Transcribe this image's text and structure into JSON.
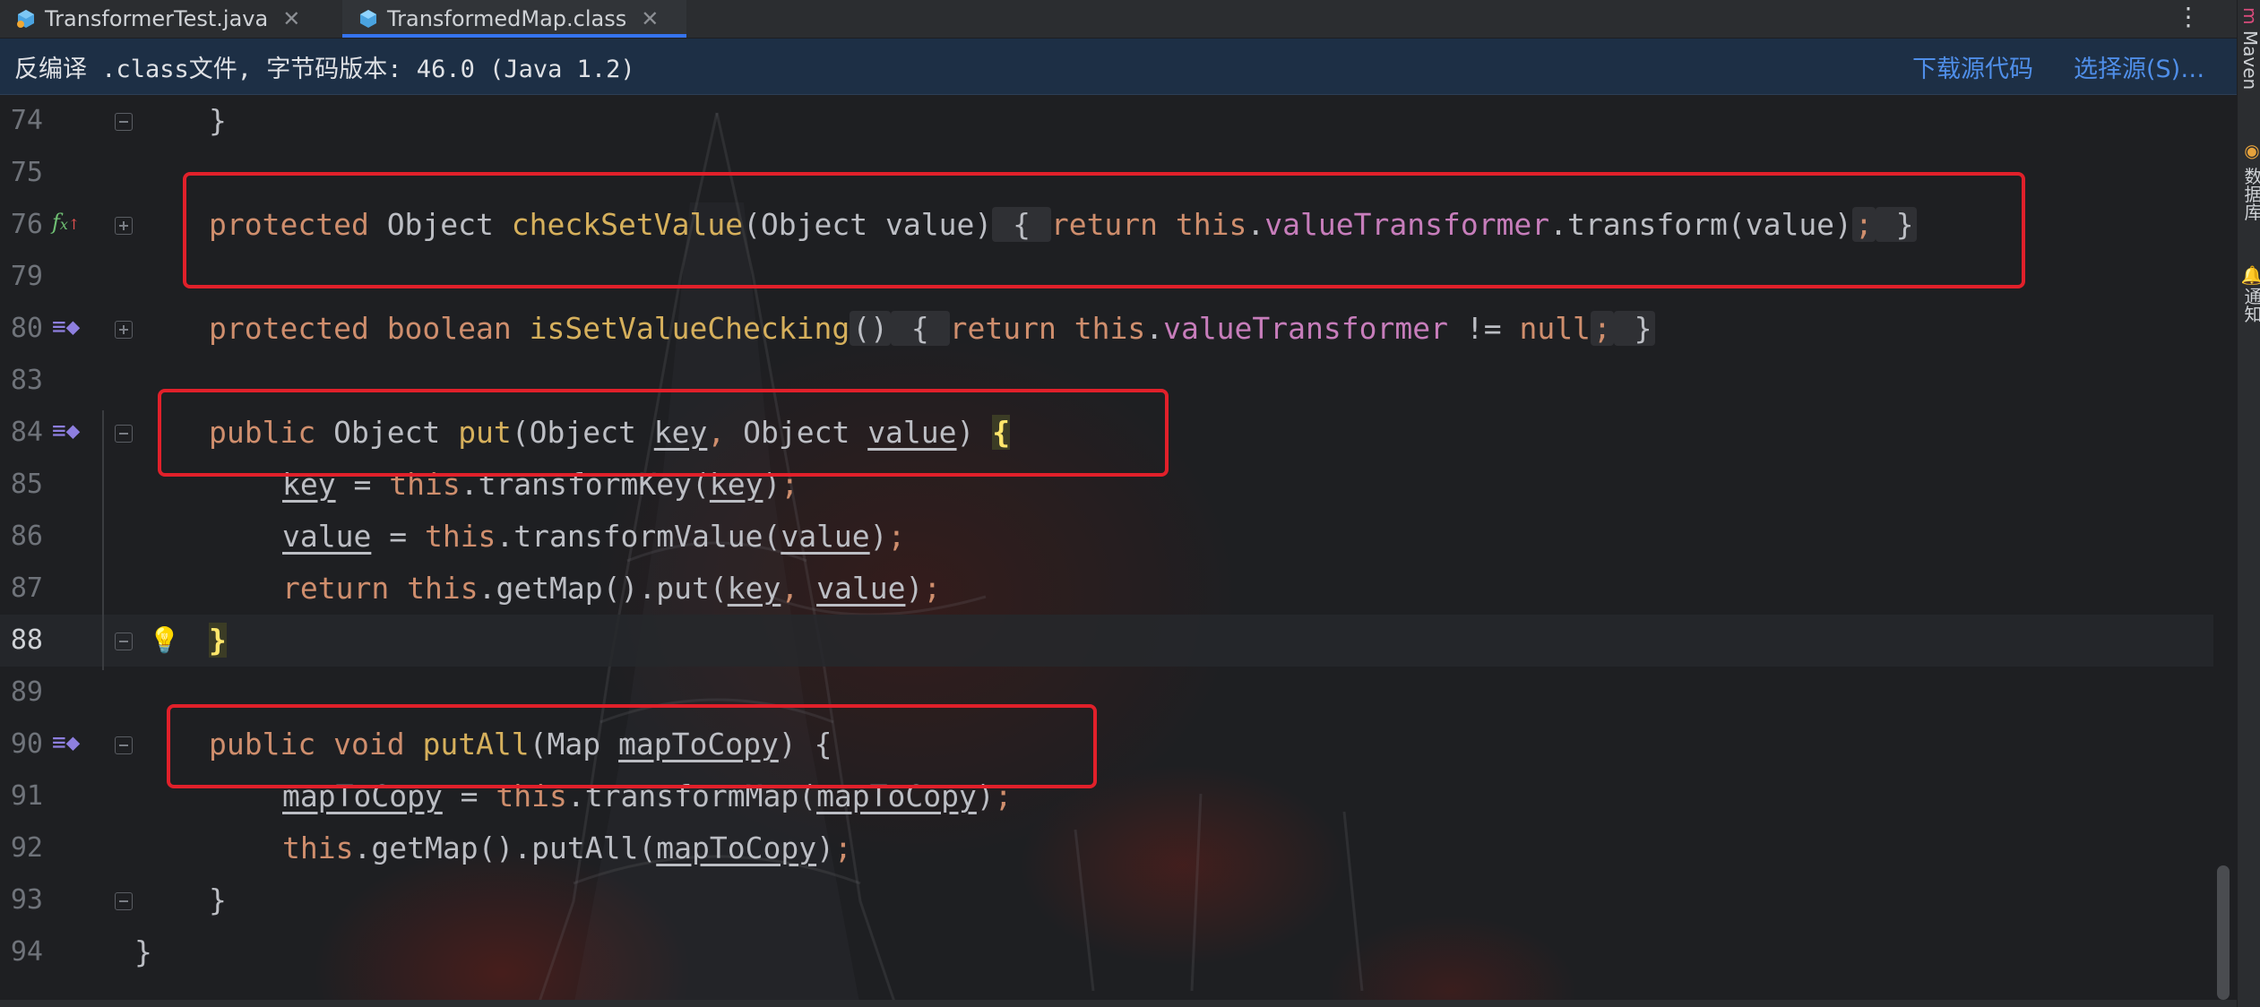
{
  "tabs": [
    {
      "label": "TransformerTest.java",
      "icon": "java-class-icon",
      "active": false
    },
    {
      "label": "TransformedMap.class",
      "icon": "class-file-icon",
      "active": true
    }
  ],
  "banner": {
    "text": "反编译 .class文件, 字节码版本: 46.0 (Java 1.2)",
    "download_link": "下载源代码",
    "choose_link": "选择源(S)…"
  },
  "right_strip": {
    "maven": "Maven",
    "database": "数据库",
    "notifications": "通知"
  },
  "colors": {
    "accent": "#3574f0",
    "highlight_box": "#e1202a",
    "keyword": "#cf8e6d",
    "method_decl": "#56a8f5",
    "field": "#c77dbb"
  },
  "code_lines": [
    {
      "number": "74"
    },
    {
      "number": "75"
    },
    {
      "number": "76"
    },
    {
      "number": "79"
    },
    {
      "number": "80"
    },
    {
      "number": "83"
    },
    {
      "number": "84"
    },
    {
      "number": "85"
    },
    {
      "number": "86"
    },
    {
      "number": "87"
    },
    {
      "number": "88",
      "current": true
    },
    {
      "number": "89"
    },
    {
      "number": "90"
    },
    {
      "number": "91"
    },
    {
      "number": "92"
    },
    {
      "number": "93"
    },
    {
      "number": "94"
    }
  ],
  "code": {
    "l74": "}",
    "l76": {
      "protected": "protected",
      "type": "Object",
      "name": "checkSetValue",
      "params": "(Object value)",
      "open": " { ",
      "ret": "return",
      "this": "this",
      "field": "valueTransformer",
      "rest": ".transform(value)",
      "semi": ";",
      "close": " }"
    },
    "l80": {
      "protected": "protected",
      "type": "boolean",
      "name": "isSetValueChecking",
      "params": "()",
      "open": " { ",
      "ret": "return",
      "this": "this",
      "field": "valueTransformer",
      "rest": " != ",
      "null": "null",
      "semi": ";",
      "close": " }"
    },
    "l84": {
      "public": "public",
      "type": "Object",
      "name": "put",
      "p1": "(Object ",
      "key": "key",
      "comma": ", ",
      "p2": "Object ",
      "value": "value",
      "p3": ") ",
      "brace": "{"
    },
    "l85": {
      "key": "key",
      "eq": " = ",
      "this": "this",
      "call": ".transformKey(",
      "arg": "key",
      "end": ")",
      "semi": ";"
    },
    "l86": {
      "value": "value",
      "eq": " = ",
      "this": "this",
      "call": ".transformValue(",
      "arg": "value",
      "end": ")",
      "semi": ";"
    },
    "l87": {
      "ret": "return",
      "this": "this",
      "call": ".getMap().put(",
      "a1": "key",
      "comma": ", ",
      "a2": "value",
      "end": ")",
      "semi": ";"
    },
    "l88": "}",
    "l90": {
      "public": "public",
      "void": "void",
      "name": "putAll",
      "p1": "(Map ",
      "arg": "mapToCopy",
      "p2": ") {"
    },
    "l91": {
      "var": "mapToCopy",
      "eq": " = ",
      "this": "this",
      "call": ".transformMap(",
      "arg": "mapToCopy",
      "end": ")",
      "semi": ";"
    },
    "l92": {
      "this": "this",
      "call": ".getMap().putAll(",
      "arg": "mapToCopy",
      "end": ")",
      "semi": ";"
    },
    "l93": "}",
    "l94": "}"
  }
}
